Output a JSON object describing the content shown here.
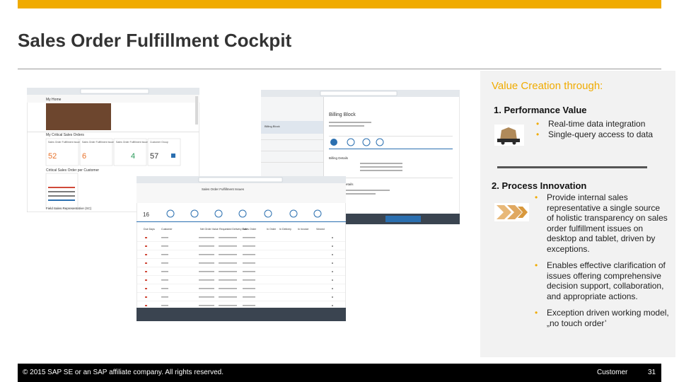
{
  "slide": {
    "title": "Sales Order Fulfillment Cockpit",
    "colors": {
      "accent": "#f0ab00",
      "footer_bg": "#000000",
      "panel_bg": "#f2f2f2"
    }
  },
  "panel": {
    "heading": "Value Creation through:",
    "sections": [
      {
        "title": "1. Performance Value",
        "icon": "truck-icon",
        "bullets": [
          "Real-time data integration",
          "Single-query access to data"
        ]
      },
      {
        "title": "2. Process Innovation",
        "icon": "chevrons-icon",
        "bullets": [
          "Provide internal sales representative a  single source of holistic transparency on sales order fulfillment issues on desktop and tablet, driven by exceptions.",
          "Enables effective clarification of issues offering comprehensive decision support, collaboration, and appropriate actions.",
          "Exception driven working model, „no touch order’"
        ]
      }
    ]
  },
  "screenshots": {
    "home": {
      "home_label": "My Home",
      "section_label": "My Critical Sales Orders",
      "tiles": [
        {
          "title": "Sales Order Fulfillment Issues",
          "value": "52",
          "value_color": "#e8722a"
        },
        {
          "title": "Sales Order Fulfillment Issues",
          "value": "6",
          "value_color": "#e8722a"
        },
        {
          "title": "Sales Order Fulfillment Issues",
          "value": "4",
          "value_color": "#2a9a5a"
        },
        {
          "title": "Customer Group",
          "value": "57",
          "value_color": "#333333"
        }
      ],
      "sub_label": "Critical Sales Order per Customer",
      "footer_label": "Field Sales Representative (SC)"
    },
    "detail": {
      "heading": "Billing Block",
      "tab_label": "Billing Block",
      "section1": "Billing Details",
      "section2": "Customer Details"
    },
    "list": {
      "count": "16",
      "header_title": "Sales Order Fulfillment Issues",
      "columns": [
        "Due Days",
        "Customer",
        "Net Order Value",
        "Requested Delivery Date",
        "Sales Order",
        "In Order",
        "In Delivery",
        "In Invoice",
        "Viewed"
      ]
    }
  },
  "footer": {
    "copyright": "© 2015 SAP SE or an SAP affiliate company. All rights reserved.",
    "audience": "Customer",
    "page": "31"
  }
}
